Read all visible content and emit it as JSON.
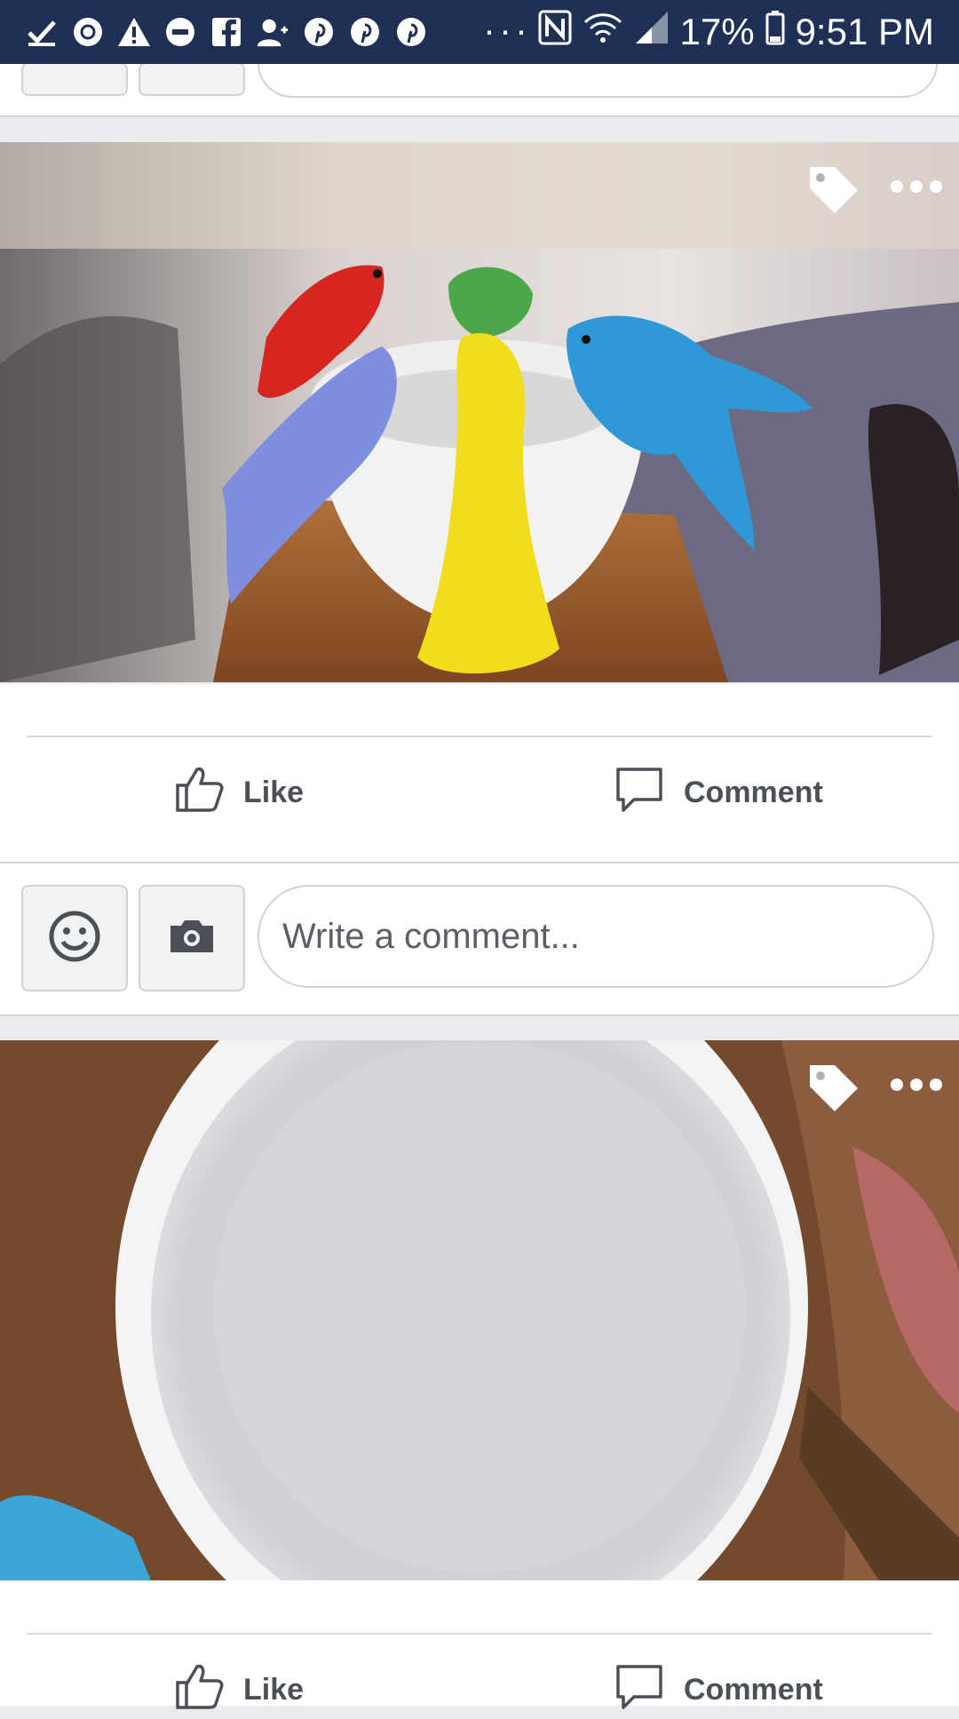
{
  "status_bar": {
    "battery": "17%",
    "time": "9:51 PM",
    "overflow": "···",
    "notification_icons": [
      "checkmark-icon",
      "settings-icon",
      "warning-icon",
      "minus-circle-icon",
      "facebook-icon",
      "add-person-icon",
      "pinterest-icon",
      "pinterest-icon",
      "pinterest-icon"
    ]
  },
  "post1": {
    "like_label": "Like",
    "comment_label": "Comment",
    "comment_placeholder": "Write a comment..."
  },
  "post2": {
    "like_label": "Like",
    "comment_label": "Comment"
  },
  "colors": {
    "status_bar_bg": "#1f2f56",
    "action_text": "#4b4f56",
    "feed_bg": "#e9ebee"
  }
}
